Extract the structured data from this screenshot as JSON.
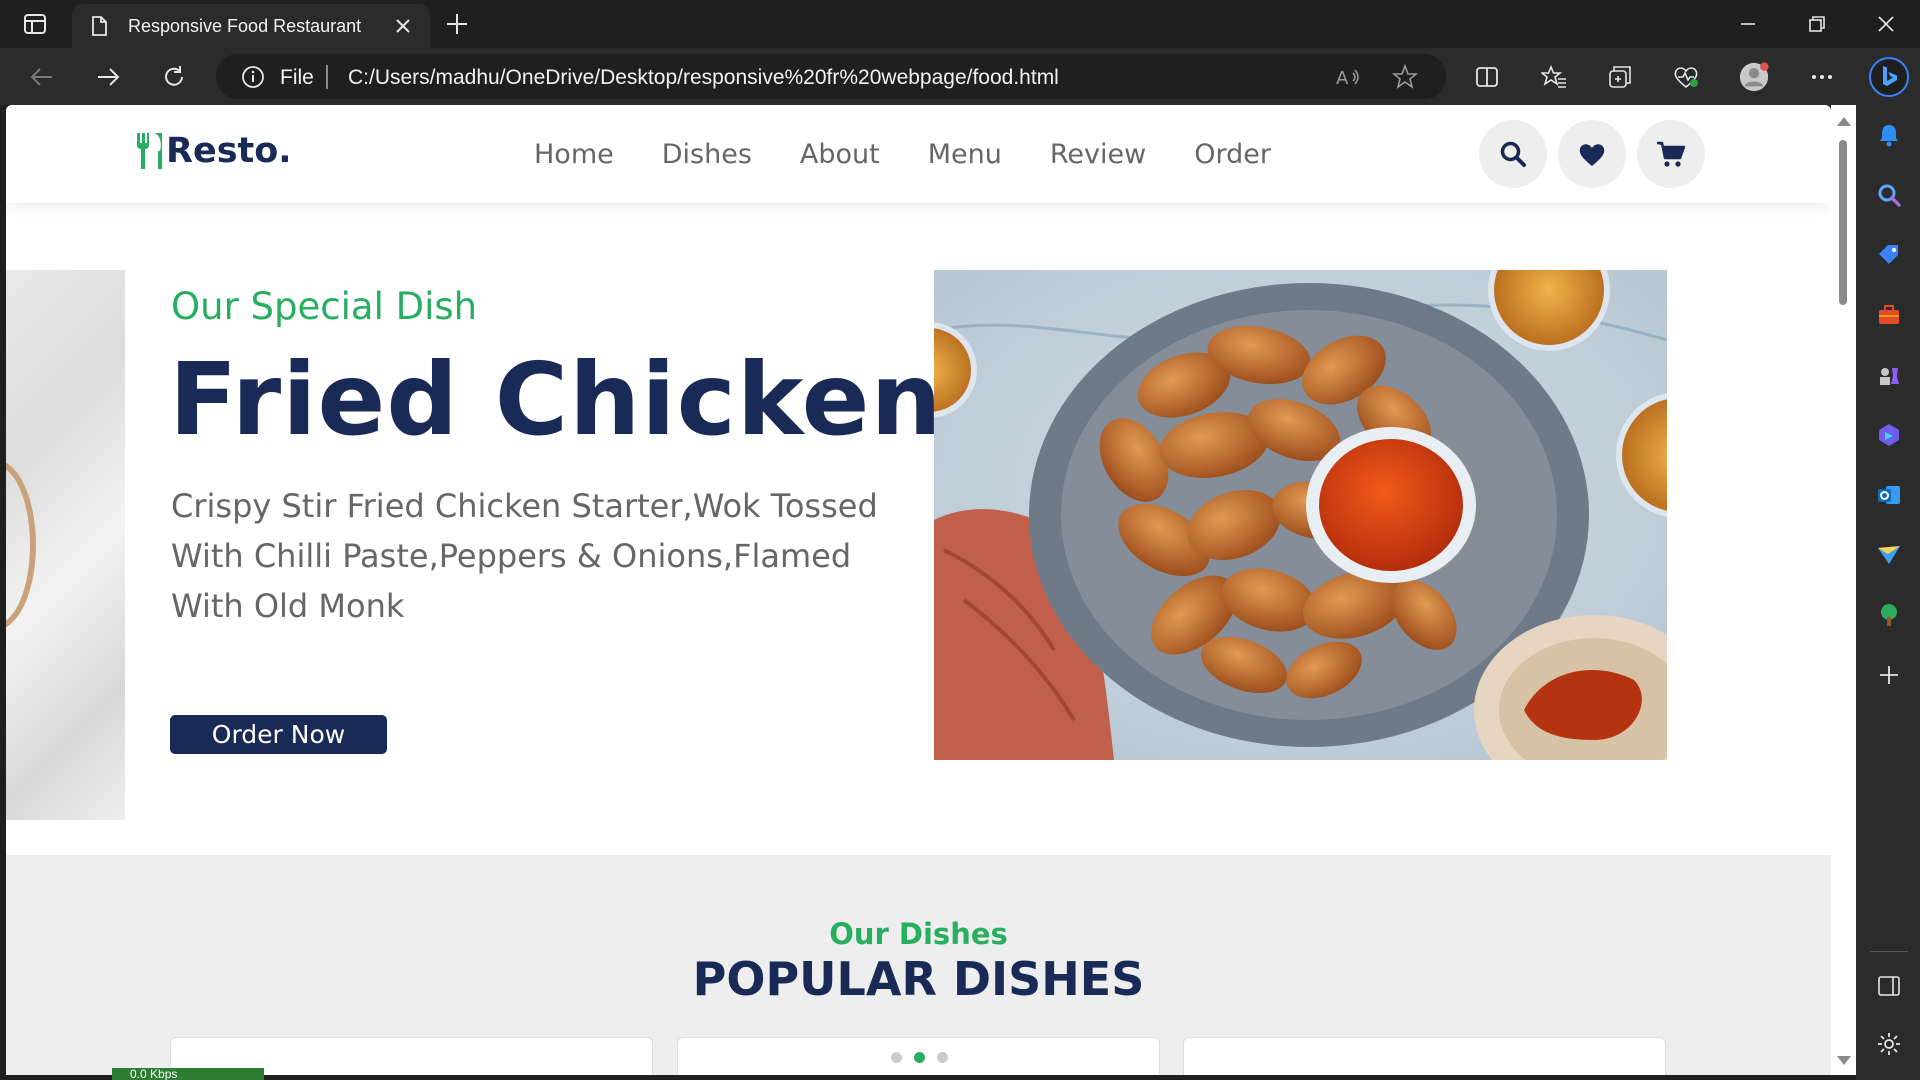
{
  "browser": {
    "tab_title": "Responsive Food Restaurant",
    "address_scheme": "File",
    "url": "C:/Users/madhu/OneDrive/Desktop/responsive%20fr%20webpage/food.html"
  },
  "site": {
    "logo_text": "Resto.",
    "nav": [
      "Home",
      "Dishes",
      "About",
      "Menu",
      "Review",
      "Order"
    ],
    "hero": {
      "subtitle": "Our Special Dish",
      "title": "Fried Chicken",
      "description": "Crispy Stir Fried Chicken Starter,Wok Tossed With Chilli Paste,Peppers & Onions,Flamed With Old Monk",
      "button": "Order Now"
    },
    "dishes": {
      "subtitle": "Our Dishes",
      "title": "POPULAR DISHES"
    }
  },
  "status": {
    "speed": "0.0 Kbps"
  },
  "colors": {
    "brand_green": "#27ae60",
    "brand_navy": "#192a56"
  }
}
